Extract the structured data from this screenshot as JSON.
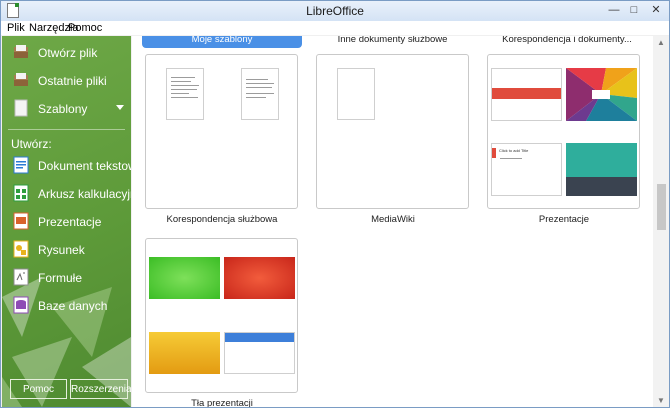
{
  "window": {
    "title": "LibreOffice",
    "controls": [
      "—",
      "□",
      "✕"
    ]
  },
  "menu": [
    "Plik",
    "Narzędzia",
    "Pomoc"
  ],
  "sidebar": {
    "top_items": [
      {
        "label": "Otwórz plik",
        "icon": "folder-open-icon"
      },
      {
        "label": "Ostatnie pliki",
        "icon": "recent-files-icon"
      },
      {
        "label": "Szablony",
        "icon": "templates-icon"
      }
    ],
    "create_label": "Utwórz:",
    "create_items": [
      {
        "label": "Dokument tekstowy",
        "icon": "writer-icon",
        "color": "#2b7bd6"
      },
      {
        "label": "Arkusz kalkulacyjny",
        "icon": "calc-icon",
        "color": "#2e9e3e"
      },
      {
        "label": "Prezentacje",
        "icon": "impress-icon",
        "color": "#d9622b"
      },
      {
        "label": "Rysunek",
        "icon": "draw-icon",
        "color": "#e8b21c"
      },
      {
        "label": "Formułe",
        "icon": "math-icon",
        "color": "#8c8c8c"
      },
      {
        "label": "Baze danych",
        "icon": "base-icon",
        "color": "#8e4bb5"
      }
    ],
    "buttons": {
      "help": "Pomoc",
      "extensions": "Rozszerzenia"
    }
  },
  "tabs": [
    {
      "label": "Moje szablony",
      "active": true
    },
    {
      "label": "Inne dokumenty służbowe",
      "active": false
    },
    {
      "label": "Korespondencja i dokumenty...",
      "active": false
    }
  ],
  "folders": [
    {
      "label": "Korespondencja służbowa"
    },
    {
      "label": "MediaWiki"
    },
    {
      "label": "Prezentacje"
    },
    {
      "label": "Tła prezentacji"
    }
  ],
  "presentation_thumbs": {
    "title_text": "Click to add Title"
  },
  "colors": {
    "sidebar": "#5d9a39",
    "accent": "#4a90e6"
  }
}
